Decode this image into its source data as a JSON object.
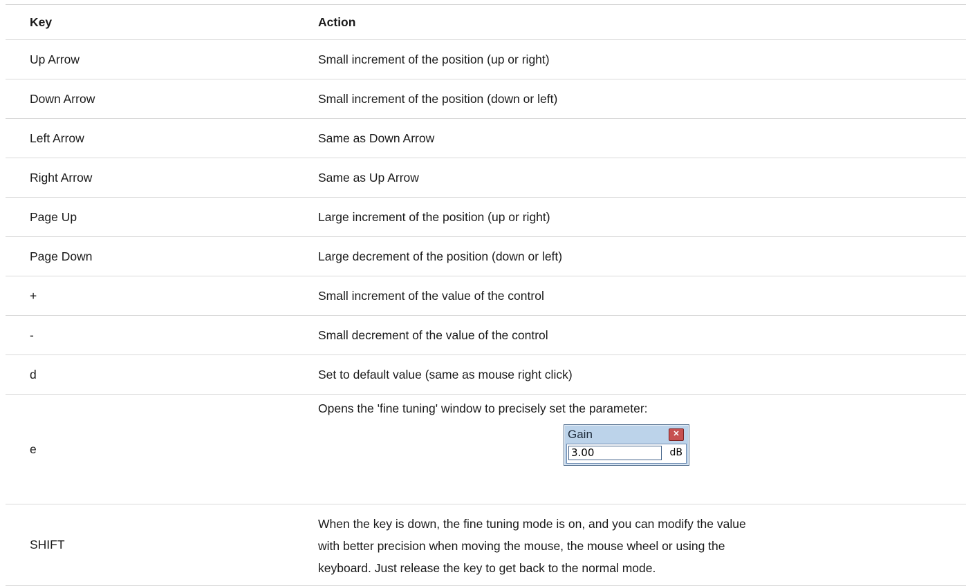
{
  "table": {
    "headers": {
      "key": "Key",
      "action": "Action"
    },
    "rows": [
      {
        "key": "Up Arrow",
        "action": "Small increment of the position (up or right)"
      },
      {
        "key": "Down Arrow",
        "action": "Small increment of the position (down or left)"
      },
      {
        "key": "Left Arrow",
        "action": "Same as Down Arrow"
      },
      {
        "key": "Right Arrow",
        "action": "Same as Up Arrow"
      },
      {
        "key": "Page Up",
        "action": "Large increment of the position (up or right)"
      },
      {
        "key": "Page Down",
        "action": "Large decrement of the position (down or left)"
      },
      {
        "key": "+",
        "action": "Small increment of the value of the control"
      },
      {
        "key": "-",
        "action": "Small decrement of the value of the control"
      },
      {
        "key": "d",
        "action": "Set to default value (same as mouse right click)"
      },
      {
        "key": "e",
        "action": "Opens the 'fine tuning' window to precisely set the parameter:"
      },
      {
        "key": "SHIFT",
        "action_lines": [
          "When the key is down, the fine tuning mode is on, and you can modify the value",
          "with better precision when moving the mouse, the mouse wheel or using the",
          "keyboard. Just release the key to get back to the normal mode."
        ]
      }
    ]
  },
  "fine_tuning_window": {
    "title": "Gain",
    "value": "3.00",
    "unit": "dB",
    "close_icon": "close-icon"
  }
}
